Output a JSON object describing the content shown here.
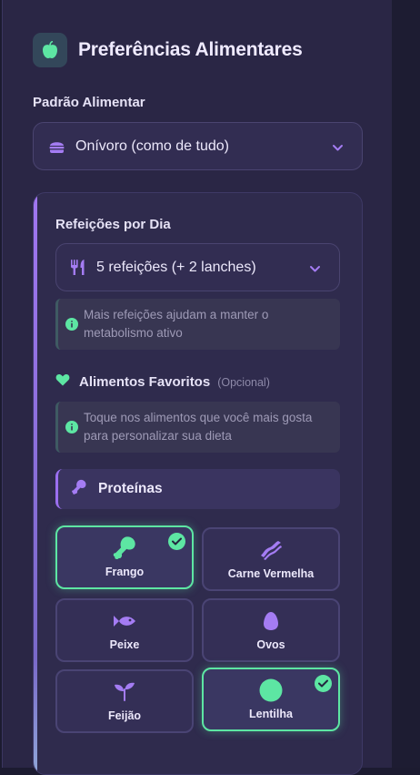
{
  "header": {
    "title": "Preferências Alimentares",
    "icon": "apple-icon"
  },
  "diet": {
    "label": "Padrão Alimentar",
    "value": "Onívoro (como de tudo)",
    "icon": "burger-icon"
  },
  "meals": {
    "label": "Refeições por Dia",
    "value": "5 refeições (+ 2 lanches)",
    "icon": "utensils-icon",
    "info": "Mais refeições ajudam a manter o metabolismo ativo"
  },
  "favorites": {
    "title": "Alimentos Favoritos",
    "optional": "(Opcional)",
    "icon": "heart-icon",
    "info": "Toque nos alimentos que você mais gosta para personalizar sua dieta"
  },
  "category": {
    "title": "Proteínas",
    "icon": "drumstick-icon",
    "items": [
      {
        "label": "Frango",
        "icon": "drumstick-icon",
        "selected": true
      },
      {
        "label": "Carne Vermelha",
        "icon": "bacon-icon",
        "selected": false
      },
      {
        "label": "Peixe",
        "icon": "fish-icon",
        "selected": false
      },
      {
        "label": "Ovos",
        "icon": "egg-icon",
        "selected": false
      },
      {
        "label": "Feijão",
        "icon": "seedling-icon",
        "selected": false
      },
      {
        "label": "Lentilha",
        "icon": "circle-icon",
        "selected": true
      }
    ]
  },
  "colors": {
    "accent": "#a47cf3",
    "selected": "#5de6a3",
    "panel": "#2a2645"
  }
}
